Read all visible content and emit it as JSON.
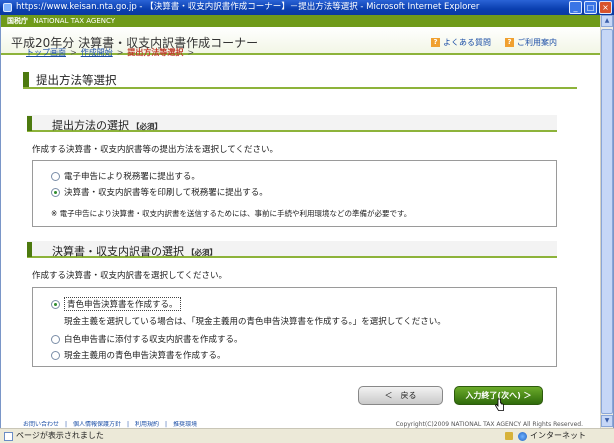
{
  "window": {
    "title": "https://www.keisan.nta.go.jp - 【決算書・収支内訳書作成コーナー】－提出方法等選択 - Microsoft Internet Explorer",
    "minimize": "_",
    "maximize": "□",
    "close": "×"
  },
  "agency_bar": {
    "name": "国税庁",
    "name_en": "NATIONAL TAX AGENCY"
  },
  "header": {
    "title": "平成20年分 決算書・収支内訳書作成コーナー",
    "links": [
      {
        "icon": "?",
        "label": "よくある質問"
      },
      {
        "icon": "?",
        "label": "ご利用案内"
      }
    ]
  },
  "breadcrumb": {
    "items": [
      "トップ画面",
      "作成開始",
      "提出方法等選択"
    ],
    "sep": ">"
  },
  "section_title": "提出方法等選択",
  "submission": {
    "title": "提出方法の選択",
    "required": "【必須】",
    "instruction": "作成する決算書・収支内訳書等の提出方法を選択してください。",
    "options": [
      {
        "label": "電子申告により税務署に提出する。",
        "selected": false
      },
      {
        "label": "決算書・収支内訳書等を印刷して税務署に提出する。",
        "selected": true
      }
    ],
    "note": "※ 電子申告により決算書・収支内訳書を送信するためには、事前に手続や利用環境などの準備が必要です。"
  },
  "document": {
    "title": "決算書・収支内訳書の選択",
    "required": "【必須】",
    "instruction": "作成する決算書・収支内訳書を選択してください。",
    "options": [
      {
        "label": "青色申告決算書を作成する。",
        "selected": true
      },
      {
        "label": "白色申告書に添付する収支内訳書を作成する。",
        "selected": false
      },
      {
        "label": "現金主義用の青色申告決算書を作成する。",
        "selected": false
      }
    ],
    "option_note": "現金主義を選択している場合は、「現金主義用の青色申告決算書を作成する。」を選択してください。"
  },
  "buttons": {
    "back": "＜　戻る",
    "next": "入力終了(次へ) ＞"
  },
  "footer": {
    "links": "お問い合わせ　|　個人情報保護方針　|　利用規約　|　推奨環境",
    "copyright": "Copyright(C)2009 NATIONAL TAX AGENCY All Rights Reserved."
  },
  "statusbar": {
    "text": "ページが表示されました",
    "zone": "インターネット"
  },
  "colors": {
    "accent_green": "#8db33a",
    "dark_green": "#4d7a0f",
    "link_blue": "#1b4ea6",
    "current_red": "#c0392b"
  }
}
